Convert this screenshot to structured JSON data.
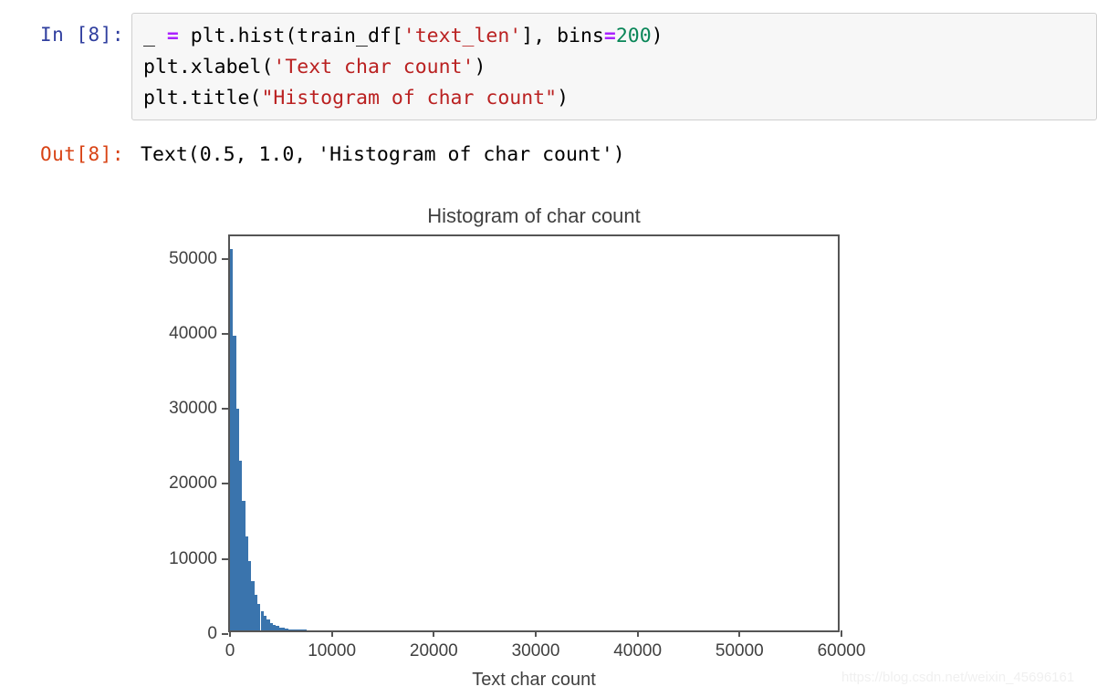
{
  "notebook": {
    "input_prompt": "In [8]:",
    "output_prompt": "Out[8]:",
    "code_lines": [
      {
        "tokens": [
          {
            "t": "_ ",
            "c": "plain"
          },
          {
            "t": "=",
            "c": "op"
          },
          {
            "t": " plt.hist(train_df[",
            "c": "plain"
          },
          {
            "t": "'text_len'",
            "c": "str"
          },
          {
            "t": "], bins",
            "c": "plain"
          },
          {
            "t": "=",
            "c": "op"
          },
          {
            "t": "200",
            "c": "num"
          },
          {
            "t": ")",
            "c": "plain"
          }
        ]
      },
      {
        "tokens": [
          {
            "t": "plt.xlabel(",
            "c": "plain"
          },
          {
            "t": "'Text char count'",
            "c": "str"
          },
          {
            "t": ")",
            "c": "plain"
          }
        ]
      },
      {
        "tokens": [
          {
            "t": "plt.title(",
            "c": "plain"
          },
          {
            "t": "\"Histogram of char count\"",
            "c": "str"
          },
          {
            "t": ")",
            "c": "plain"
          }
        ]
      }
    ],
    "output_text": "Text(0.5, 1.0, 'Histogram of char count')"
  },
  "watermark": "https://blog.csdn.net/weixin_45696161",
  "colors": {
    "bar": "#3a74ad",
    "axis": "#555555",
    "tick_text": "#404040",
    "prompt_in": "#303f9f",
    "prompt_out": "#d84315",
    "cell_bg": "#f7f7f7",
    "string_token": "#ba2121",
    "operator_token": "#aa22ff",
    "number_token": "#098658"
  },
  "chart_data": {
    "type": "bar",
    "title": "Histogram of char count",
    "xlabel": "Text char count",
    "ylabel": "",
    "xlim": [
      0,
      60000
    ],
    "ylim": [
      0,
      53000
    ],
    "xticks": [
      0,
      10000,
      20000,
      30000,
      40000,
      50000,
      60000
    ],
    "xtick_labels": [
      "0",
      "10000",
      "20000",
      "30000",
      "40000",
      "50000",
      "60000"
    ],
    "yticks": [
      0,
      10000,
      20000,
      30000,
      40000,
      50000
    ],
    "ytick_labels": [
      "0",
      "10000",
      "20000",
      "30000",
      "40000",
      "50000"
    ],
    "grid": false,
    "legend": null,
    "bins": 200,
    "bin_width": 300,
    "x": [
      0,
      300,
      600,
      900,
      1200,
      1500,
      1800,
      2100,
      2400,
      2700,
      3000,
      3300,
      3600,
      3900,
      4200,
      4500,
      4800,
      5100,
      5400,
      5700,
      6000,
      6300,
      6600,
      6900,
      7200
    ],
    "values": [
      50800,
      39300,
      29500,
      22600,
      17300,
      12500,
      9200,
      6600,
      4800,
      3500,
      2600,
      1900,
      1400,
      1000,
      750,
      560,
      420,
      320,
      240,
      180,
      140,
      100,
      75,
      55,
      40
    ]
  }
}
